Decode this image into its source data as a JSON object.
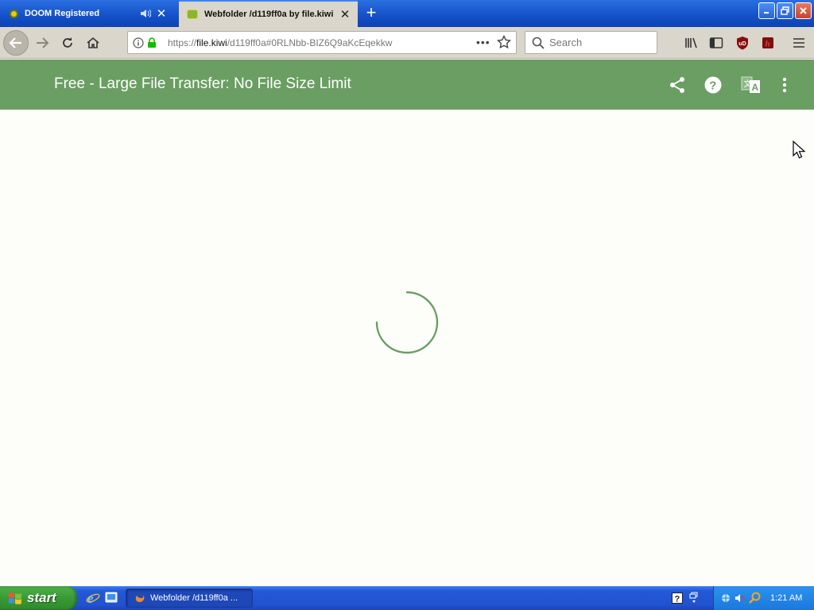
{
  "browser": {
    "tabs": [
      {
        "title": "DOOM Registered",
        "active": false,
        "audio": true
      },
      {
        "title": "Webfolder /d119ff0a by file.kiwi",
        "active": true
      }
    ],
    "url": {
      "scheme": "https://",
      "host": "file.kiwi",
      "path": "/d119ff0a#0RLNbb-BIZ6Q9aKcEqekkw"
    },
    "search_placeholder": "Search"
  },
  "page": {
    "title": "Free - Large File Transfer: No File Size Limit",
    "loading": true,
    "accent_color": "#6a9e62"
  },
  "icons": [
    "back-arrow-icon",
    "forward-arrow-icon",
    "reload-icon",
    "home-icon",
    "info-icon",
    "lock-icon",
    "page-actions-icon",
    "star-icon",
    "search-icon",
    "library-icon",
    "sidebar-icon",
    "ublock-icon",
    "extension-icon",
    "hamburger-menu-icon",
    "share-icon",
    "help-icon",
    "translate-icon",
    "more-vert-icon"
  ],
  "taskbar": {
    "start_label": "start",
    "tasks": [
      {
        "label": "Webfolder /d119ff0a ..."
      }
    ],
    "clock": "1:21 AM"
  }
}
